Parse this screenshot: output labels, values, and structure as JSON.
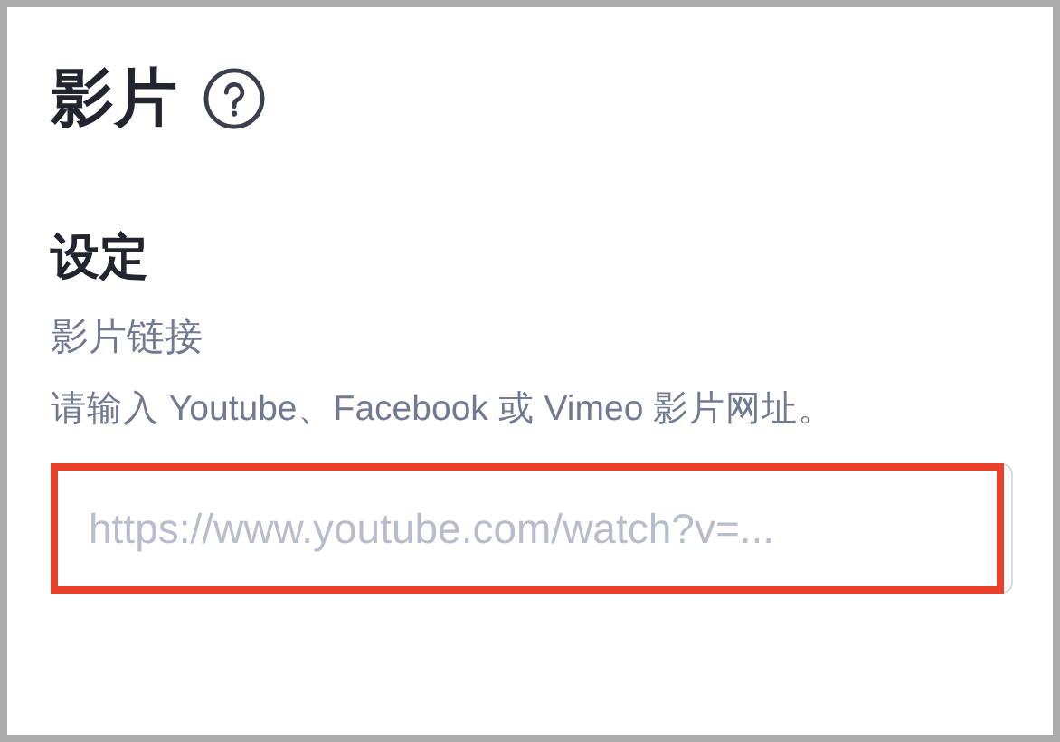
{
  "title": "影片",
  "section": {
    "heading": "设定",
    "field": {
      "label": "影片链接",
      "help": "请输入 Youtube、Facebook 或 Vimeo 影片网址。",
      "placeholder": "https://www.youtube.com/watch?v=...",
      "highlighted": true
    }
  }
}
